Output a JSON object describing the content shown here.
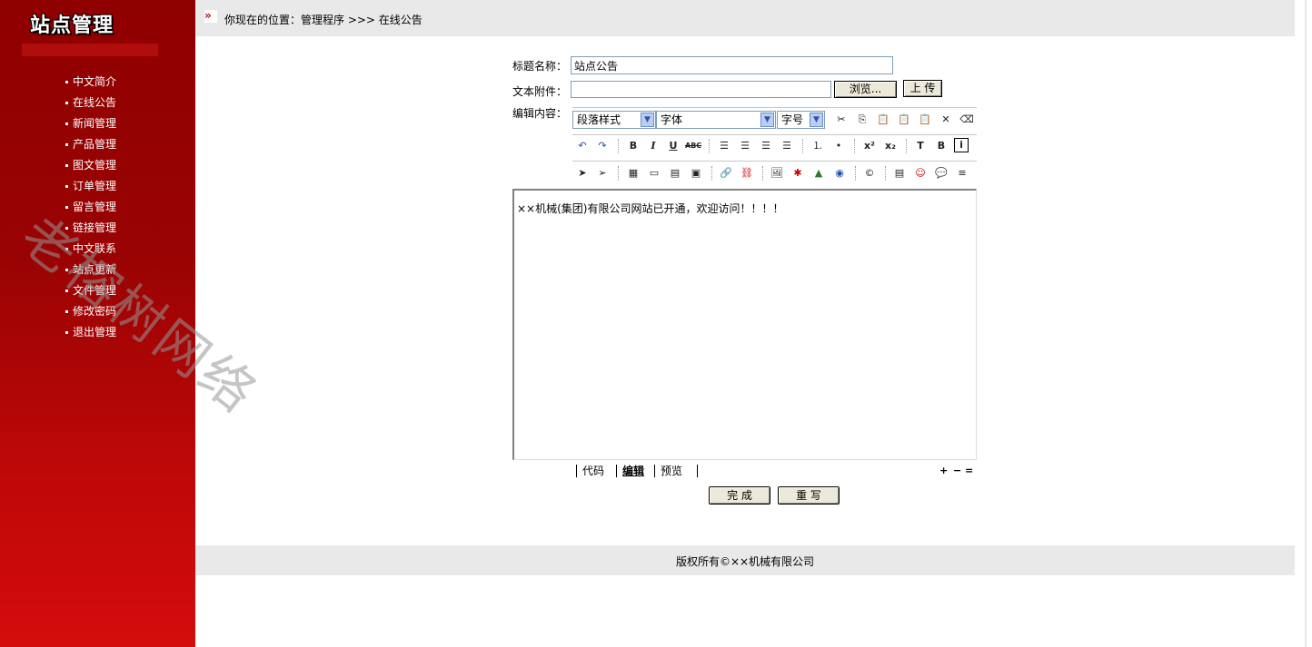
{
  "sidebar": {
    "title": "站点管理",
    "items": [
      {
        "label": "中文简介"
      },
      {
        "label": "在线公告"
      },
      {
        "label": "新闻管理"
      },
      {
        "label": "产品管理"
      },
      {
        "label": "图文管理"
      },
      {
        "label": "订单管理"
      },
      {
        "label": "留言管理"
      },
      {
        "label": "链接管理"
      },
      {
        "label": "中文联系"
      },
      {
        "label": "站点更新"
      },
      {
        "label": "文件管理"
      },
      {
        "label": "修改密码"
      },
      {
        "label": "退出管理"
      }
    ]
  },
  "watermark": "老榕树网络",
  "breadcrumb": {
    "prefix": "你现在的位置：管理程序 >>> 在线公告"
  },
  "form": {
    "title_label": "标题名称：",
    "title_value": "站点公告",
    "attach_label": "文本附件：",
    "attach_value": "",
    "browse_label": "浏览...",
    "upload_label": "上 传",
    "content_label": "编辑内容：",
    "paragraph_style": "段落样式",
    "font": "字体",
    "font_size": "字号",
    "content_text": "××机械(集团)有限公司网站已开通，欢迎访问！！！！",
    "tabs": [
      "代码",
      "编辑",
      "预览"
    ],
    "size_controls": [
      "+",
      "−",
      "="
    ],
    "submit_label": "完 成",
    "reset_label": "重 写"
  },
  "footer": {
    "copyright": "版权所有©××机械有限公司"
  }
}
